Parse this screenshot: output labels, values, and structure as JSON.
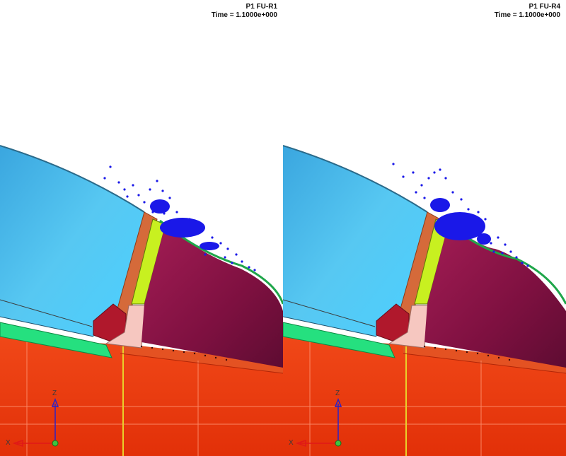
{
  "viewports": [
    {
      "id": "left",
      "title": "P1 FU-R1",
      "time_label": "Time = 1.1000e+000",
      "triad": {
        "x": "X",
        "z": "Z"
      }
    },
    {
      "id": "right",
      "title": "P1 FU-R4",
      "time_label": "Time = 1.1000e+000",
      "triad": {
        "x": "X",
        "z": "Z"
      }
    }
  ],
  "colors": {
    "panel_blue": "#4fc3ef",
    "panel_blue_dark": "#1f86c2",
    "chamber_magenta": "#8a1545",
    "floor_red": "#ea3a10",
    "seal_green": "#22e080",
    "frame_lime": "#c8f020",
    "particles": "#1a18e8",
    "gasket_pink": "#f6c7c0",
    "bracket_brown": "#d56a3a"
  }
}
